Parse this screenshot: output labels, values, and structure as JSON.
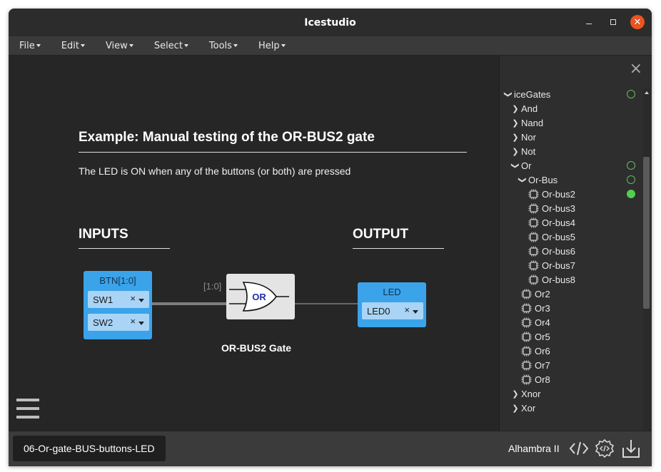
{
  "window": {
    "title": "Icestudio"
  },
  "menu": [
    {
      "label": "File"
    },
    {
      "label": "Edit"
    },
    {
      "label": "View"
    },
    {
      "label": "Select"
    },
    {
      "label": "Tools"
    },
    {
      "label": "Help"
    }
  ],
  "canvas": {
    "title": "Example: Manual testing of the OR-BUS2 gate",
    "description": "The LED is ON when any of the buttons (or both) are pressed",
    "inputs_heading": "INPUTS",
    "output_heading": "OUTPUT",
    "input_block": {
      "label": "BTN[1:0]",
      "pins": [
        {
          "value": "SW1",
          "clear": "×"
        },
        {
          "value": "SW2",
          "clear": "×"
        }
      ]
    },
    "wire_label": "[1:0]",
    "gate": {
      "symbol_text": "OR",
      "caption": "OR-BUS2 Gate"
    },
    "output_block": {
      "label": "LED",
      "pins": [
        {
          "value": "LED0",
          "clear": "×"
        }
      ]
    }
  },
  "sidebar": {
    "close_icon": "×",
    "tree": [
      {
        "label": "iceGates",
        "icon": "chevron-down",
        "indent": 0,
        "status": "open"
      },
      {
        "label": "And",
        "icon": "chevron-right",
        "indent": 1,
        "status": ""
      },
      {
        "label": "Nand",
        "icon": "chevron-right",
        "indent": 1,
        "status": ""
      },
      {
        "label": "Nor",
        "icon": "chevron-right",
        "indent": 1,
        "status": ""
      },
      {
        "label": "Not",
        "icon": "chevron-right",
        "indent": 1,
        "status": ""
      },
      {
        "label": "Or",
        "icon": "chevron-down",
        "indent": 1,
        "status": "open"
      },
      {
        "label": "Or-Bus",
        "icon": "chevron-down",
        "indent": 2,
        "status": "open"
      },
      {
        "label": "Or-bus2",
        "icon": "chip",
        "indent": 3,
        "status": "active"
      },
      {
        "label": "Or-bus3",
        "icon": "chip",
        "indent": 3,
        "status": ""
      },
      {
        "label": "Or-bus4",
        "icon": "chip",
        "indent": 3,
        "status": ""
      },
      {
        "label": "Or-bus5",
        "icon": "chip",
        "indent": 3,
        "status": ""
      },
      {
        "label": "Or-bus6",
        "icon": "chip",
        "indent": 3,
        "status": ""
      },
      {
        "label": "Or-bus7",
        "icon": "chip",
        "indent": 3,
        "status": ""
      },
      {
        "label": "Or-bus8",
        "icon": "chip",
        "indent": 3,
        "status": ""
      },
      {
        "label": "Or2",
        "icon": "chip",
        "indent": 2,
        "status": ""
      },
      {
        "label": "Or3",
        "icon": "chip",
        "indent": 2,
        "status": ""
      },
      {
        "label": "Or4",
        "icon": "chip",
        "indent": 2,
        "status": ""
      },
      {
        "label": "Or5",
        "icon": "chip",
        "indent": 2,
        "status": ""
      },
      {
        "label": "Or6",
        "icon": "chip",
        "indent": 2,
        "status": ""
      },
      {
        "label": "Or7",
        "icon": "chip",
        "indent": 2,
        "status": ""
      },
      {
        "label": "Or8",
        "icon": "chip",
        "indent": 2,
        "status": ""
      },
      {
        "label": "Xnor",
        "icon": "chevron-right",
        "indent": 1,
        "status": ""
      },
      {
        "label": "Xor",
        "icon": "chevron-right",
        "indent": 1,
        "status": ""
      }
    ]
  },
  "statusbar": {
    "file_name": "06-Or-gate-BUS-buttons-LED",
    "board": "Alhambra II"
  },
  "colors": {
    "block_blue": "#3aa3ea",
    "pin_bg": "#a9d4f5",
    "status_green": "#4fd04f",
    "close_orange": "#e95420"
  }
}
